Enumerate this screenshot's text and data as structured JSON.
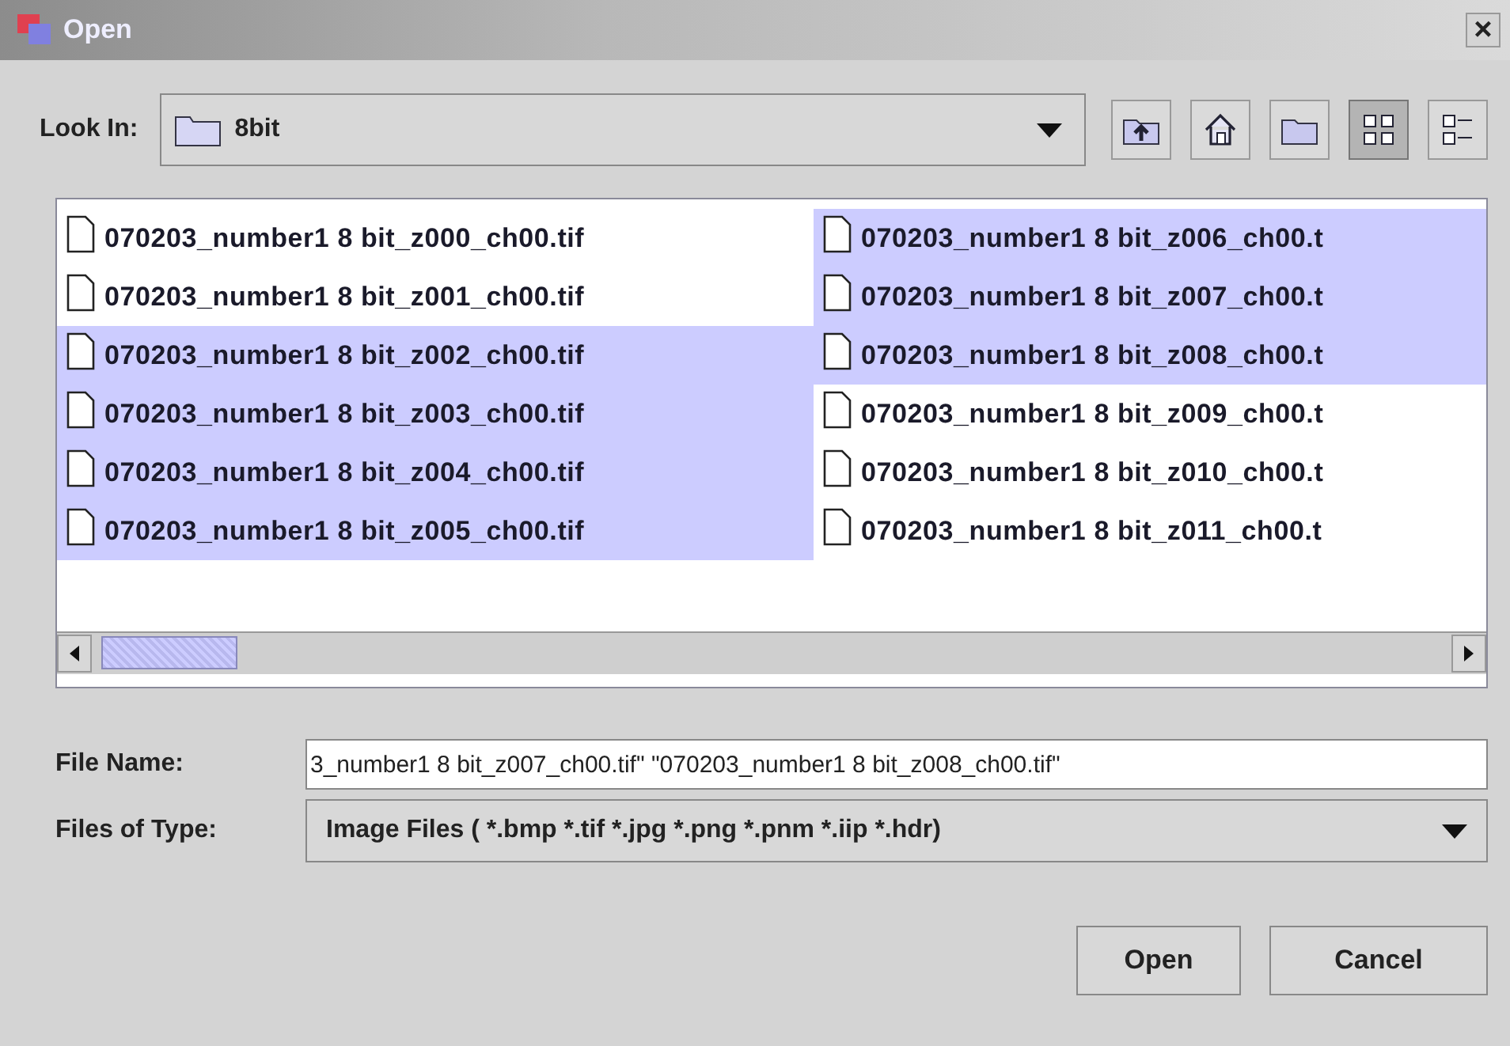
{
  "window": {
    "title": "Open",
    "close": "×"
  },
  "look_in": {
    "label": "Look In:",
    "value": "8bit"
  },
  "toolbar": [
    {
      "kind": "up",
      "selected": false
    },
    {
      "kind": "home",
      "selected": false
    },
    {
      "kind": "new-folder",
      "selected": false
    },
    {
      "kind": "list",
      "selected": true
    },
    {
      "kind": "details",
      "selected": false
    }
  ],
  "files": [
    {
      "name": "070203_number1 8 bit_z000_ch00.tif",
      "selected": false
    },
    {
      "name": "070203_number1 8 bit_z001_ch00.tif",
      "selected": false
    },
    {
      "name": "070203_number1 8 bit_z002_ch00.tif",
      "selected": true
    },
    {
      "name": "070203_number1 8 bit_z003_ch00.tif",
      "selected": true
    },
    {
      "name": "070203_number1 8 bit_z004_ch00.tif",
      "selected": true
    },
    {
      "name": "070203_number1 8 bit_z005_ch00.tif",
      "selected": true
    },
    {
      "name": "070203_number1 8 bit_z006_ch00.t",
      "selected": true
    },
    {
      "name": "070203_number1 8 bit_z007_ch00.t",
      "selected": true
    },
    {
      "name": "070203_number1 8 bit_z008_ch00.t",
      "selected": true
    },
    {
      "name": "070203_number1 8 bit_z009_ch00.t",
      "selected": false
    },
    {
      "name": "070203_number1 8 bit_z010_ch00.t",
      "selected": false
    },
    {
      "name": "070203_number1 8 bit_z011_ch00.t",
      "selected": false
    }
  ],
  "file_name": {
    "label": "File Name:",
    "value": "3_number1 8 bit_z007_ch00.tif\" \"070203_number1 8 bit_z008_ch00.tif\""
  },
  "files_of_type": {
    "label": "Files of Type:",
    "value": "Image Files ( *.bmp *.tif *.jpg *.png *.pnm *.iip *.hdr)"
  },
  "buttons": [
    "Open",
    "Cancel"
  ]
}
